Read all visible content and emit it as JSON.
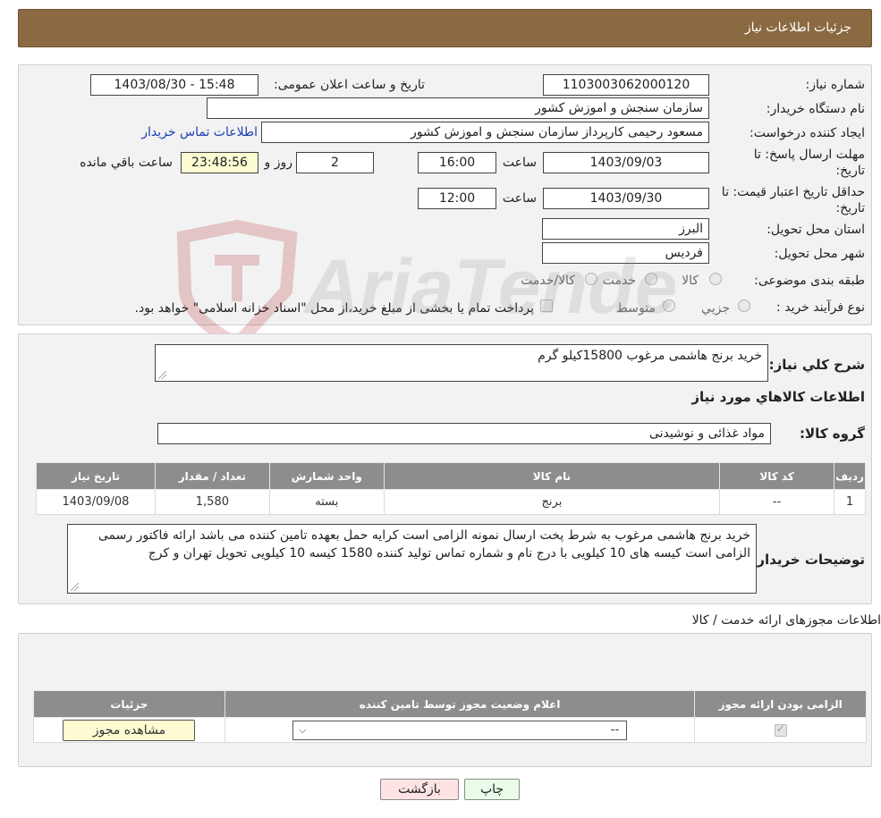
{
  "header": {
    "title": "جزئیات اطلاعات نیاز"
  },
  "form": {
    "need_number_label": "شماره نیاز:",
    "need_number": "1103003062000120",
    "announce_label": "تاریخ و ساعت اعلان عمومی:",
    "announce_value": "1403/08/30 - 15:48",
    "buyer_org_label": "نام دستگاه خریدار:",
    "buyer_org": "سازمان سنجش و اموزش کشور",
    "creator_label": "ایجاد کننده درخواست:",
    "creator": "مسعود رحیمی کارپرداز سازمان سنجش و اموزش کشور",
    "contact_link": "اطلاعات تماس خریدار",
    "deadline_label_1": "مهلت ارسال پاسخ: تا",
    "deadline_label_2": "تاریخ:",
    "deadline_date": "1403/09/03",
    "time_label": "ساعت",
    "deadline_time": "16:00",
    "days_value": "2",
    "days_label": "روز و",
    "remaining_time": "23:48:56",
    "remaining_label": "ساعت باقي مانده",
    "validity_label_1": "حداقل تاریخ اعتبار قیمت: تا",
    "validity_label_2": "تاریخ:",
    "validity_date": "1403/09/30",
    "validity_time_label": "ساعت",
    "validity_time": "12:00",
    "province_label": "استان محل تحویل:",
    "province": "البرز",
    "city_label": "شهر محل تحویل:",
    "city": "فردیس",
    "category_label": "طبقه بندی موضوعی:",
    "category_options": [
      "کالا",
      "خدمت",
      "کالا/خدمت"
    ],
    "process_label": "نوع فرآیند خرید :",
    "process_options": [
      "جزيي",
      "متوسط"
    ],
    "process_note": "پرداخت تمام یا بخشی از مبلغ خرید،از محل \"اسناد خزانه اسلامی\" خواهد بود."
  },
  "summary": {
    "desc_label": "شرح کلي نياز:",
    "desc_value": "خرید برنج هاشمی مرغوب  15800کیلو گرم",
    "goods_title": "اطلاعات کالاهاي مورد نياز",
    "group_label": "گروه کالا:",
    "group_value": "مواد غذائی و نوشیدنی",
    "table": {
      "headers": [
        "رديف",
        "کد کالا",
        "نام کالا",
        "واحد شمارش",
        "تعداد / مقدار",
        "تاریخ نیاز"
      ],
      "rows": [
        [
          "1",
          "--",
          "برنج",
          "بسته",
          "1,580",
          "1403/09/08"
        ]
      ]
    },
    "buyer_notes_label": "توضیحات خریدار:",
    "buyer_notes": "خرید برنج هاشمی مرغوب به شرط پخت ارسال نمونه الزامی است کرایه حمل بعهده تامین کننده می باشد ارائه فاکتور رسمی الزامی است کیسه های 10 کیلویی با درج نام  و شماره تماس تولید کننده 1580 کیسه 10 کیلویی تحویل تهران و کرج"
  },
  "licenses": {
    "title": "اطلاعات مجوزهای ارائه خدمت / کالا",
    "headers": [
      "الزامی بودن ارائه مجوز",
      "اعلام وضعیت مجوز توسط تامین کننده",
      "جزئیات"
    ],
    "select_value": "--",
    "view_button": "مشاهده مجوز"
  },
  "footer": {
    "print_button": "چاپ",
    "back_button": "بازگشت"
  },
  "watermark_text": "AriaTender.neT",
  "colors": {
    "header_bg": "#8b6a43",
    "table_header_bg": "#8d8d8d",
    "link": "#1a3fb0",
    "highlight": "#fdfbd2",
    "back_button_bg": "#fde3e3",
    "print_button_bg": "#eafbe8"
  }
}
